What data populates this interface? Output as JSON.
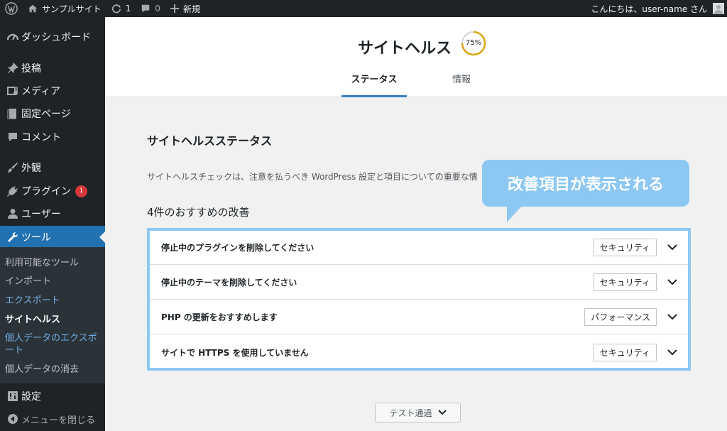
{
  "adminbar": {
    "site_name": "サンプルサイト",
    "updates_count": "1",
    "comments_count": "0",
    "new_label": "新規",
    "greeting": "こんにちは、user-name さん"
  },
  "sidebar": {
    "dashboard": "ダッシュボード",
    "posts": "投稿",
    "media": "メディア",
    "pages": "固定ページ",
    "comments": "コメント",
    "appearance": "外観",
    "plugins": "プラグイン",
    "plugins_badge": "1",
    "users": "ユーザー",
    "tools": "ツール",
    "submenu": {
      "available_tools": "利用可能なツール",
      "import": "インポート",
      "export": "エクスポート",
      "site_health": "サイトヘルス",
      "export_personal": "個人データのエクスポート",
      "erase_personal": "個人データの消去"
    },
    "settings": "設定",
    "collapse": "メニューを閉じる"
  },
  "header": {
    "title": "サイトヘルス",
    "progress_label": "75%",
    "progress_value": 0.75,
    "tabs": [
      "ステータス",
      "情報"
    ]
  },
  "main": {
    "section_title": "サイトヘルスステータス",
    "description": "サイトヘルスチェックは、注意を払うべき WordPress 設定と項目についての重要な情",
    "recommend_heading": "4件のおすすめの改善",
    "items": [
      {
        "title": "停止中のプラグインを削除してください",
        "badge": "セキュリティ"
      },
      {
        "title": "停止中のテーマを削除してください",
        "badge": "セキュリティ"
      },
      {
        "title": "PHP の更新をおすすめします",
        "badge": "パフォーマンス"
      },
      {
        "title": "サイトで HTTPS を使用していません",
        "badge": "セキュリティ"
      }
    ],
    "passed_label": "テスト通過"
  },
  "callout": {
    "text": "改善項目が表示される"
  },
  "colors": {
    "accent": "#2271b1",
    "callout": "#8dc8f3",
    "progress": "#dba617"
  }
}
